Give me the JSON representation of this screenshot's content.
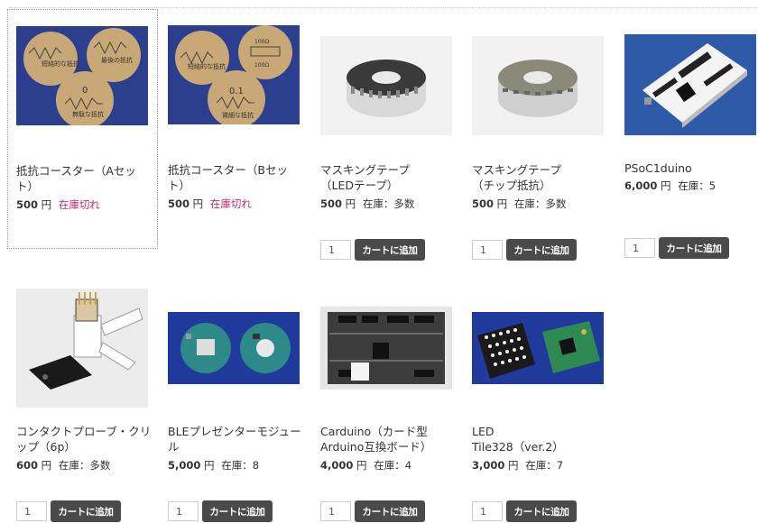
{
  "products": [
    {
      "title": "抵抗コースター（Aセット）",
      "price": "500",
      "yen": "円",
      "stock_label": "在庫切れ",
      "qty": ""
    },
    {
      "title": "抵抗コースター（Bセット）",
      "price": "500",
      "yen": "円",
      "stock_label": "在庫切れ",
      "qty": ""
    },
    {
      "title": "マスキングテープ\n（LEDテープ）",
      "price": "500",
      "yen": "円",
      "stock_label": "在庫：多数",
      "qty": "1",
      "cart_label": "カートに追加"
    },
    {
      "title": "マスキングテープ\n（チップ抵抗）",
      "price": "500",
      "yen": "円",
      "stock_label": "在庫：多数",
      "qty": "1",
      "cart_label": "カートに追加"
    },
    {
      "title": "PSoC1duino",
      "price": "6,000",
      "yen": "円",
      "stock_label": "在庫：5",
      "qty": "1",
      "cart_label": "カートに追加"
    },
    {
      "title": "コンタクトプローブ・クリップ（6p）",
      "price": "600",
      "yen": "円",
      "stock_label": "在庫：多数",
      "qty": "1",
      "cart_label": "カートに追加"
    },
    {
      "title": "BLEプレゼンターモジュール",
      "price": "5,000",
      "yen": "円",
      "stock_label": "在庫：8",
      "qty": "1",
      "cart_label": "カートに追加"
    },
    {
      "title": "Carduino（カード型Arduino互換ボード）",
      "price": "4,000",
      "yen": "円",
      "stock_label": "在庫：4",
      "qty": "1",
      "cart_label": "カートに追加"
    },
    {
      "title": "LED\nTile328（ver.2）",
      "price": "3,000",
      "yen": "円",
      "stock_label": "在庫：7",
      "qty": "1",
      "cart_label": "カートに追加"
    }
  ],
  "coaster_a_labels": [
    "短絡的な抵抗",
    "最後の抵抗",
    "0",
    "無駄な抵抗"
  ],
  "coaster_b_labels": [
    "短絡的な抵抗",
    "0.1",
    "微細な抵抗",
    "100Ω",
    "100Ω"
  ]
}
